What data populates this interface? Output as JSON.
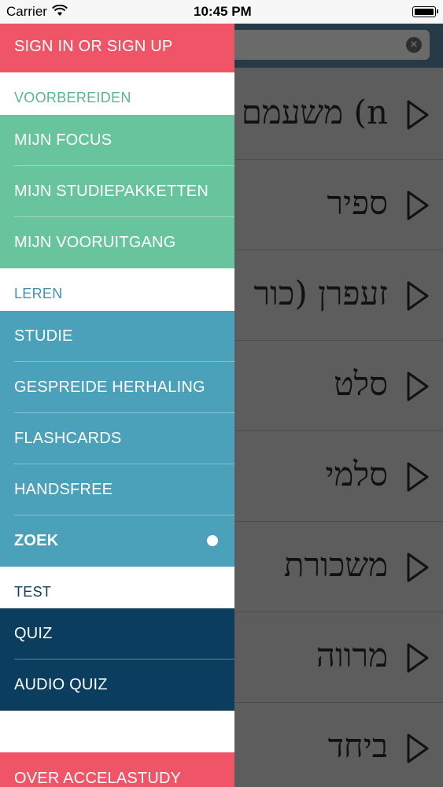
{
  "status_bar": {
    "carrier": "Carrier",
    "time": "10:45 PM",
    "battery_level": 1.0
  },
  "background": {
    "search": {
      "clear_icon": "clear-icon"
    },
    "words": [
      "משעמם (n",
      "ספיר",
      "זעפרן (כור",
      "סלט",
      "סלמי",
      "משכורת",
      "מרווה",
      "ביחד"
    ]
  },
  "drawer": {
    "sign_in": "SIGN IN OR SIGN UP",
    "sections": {
      "prepare": "VOORBEREIDEN",
      "learn": "LEREN",
      "test": "TEST"
    },
    "prepare_items": [
      "MIJN FOCUS",
      "MIJN STUDIEPAKKETTEN",
      "MIJN VOORUITGANG"
    ],
    "learn_items": [
      "STUDIE",
      "GESPREIDE HERHALING",
      "FLASHCARDS",
      "HANDSFREE",
      "ZOEK"
    ],
    "test_items": [
      "QUIZ",
      "AUDIO QUIZ"
    ],
    "about": "OVER ACCELASTUDY",
    "active_item": "ZOEK"
  },
  "colors": {
    "red": "#ef5566",
    "green": "#68c49c",
    "green_text": "#55b88c",
    "teal": "#4aa1b9",
    "teal_text": "#3f93ab",
    "navy": "#0b3d5e",
    "navy_text": "#0b3d5e"
  }
}
